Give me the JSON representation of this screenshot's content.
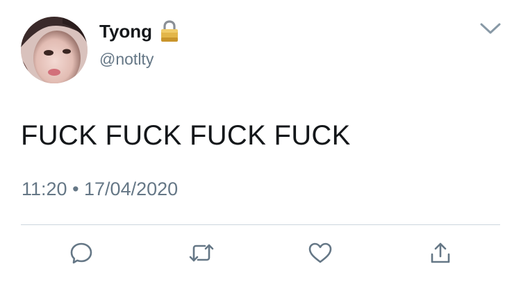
{
  "user": {
    "display_name": "Tyong",
    "handle": "@notlty",
    "verified_icon": "lock-icon"
  },
  "tweet": {
    "text": "FUCK FUCK FUCK FUCK",
    "time": "11:20",
    "separator": "•",
    "date": "17/04/2020",
    "timestamp": "11:20 • 17/04/2020"
  },
  "actions": {
    "reply": "reply-icon",
    "retweet": "retweet-icon",
    "like": "heart-icon",
    "share": "share-icon"
  },
  "colors": {
    "text": "#14171a",
    "secondary": "#657786",
    "icon": "#657786",
    "divider": "#ccd6dd",
    "lock_gold": "#d4a73a"
  }
}
